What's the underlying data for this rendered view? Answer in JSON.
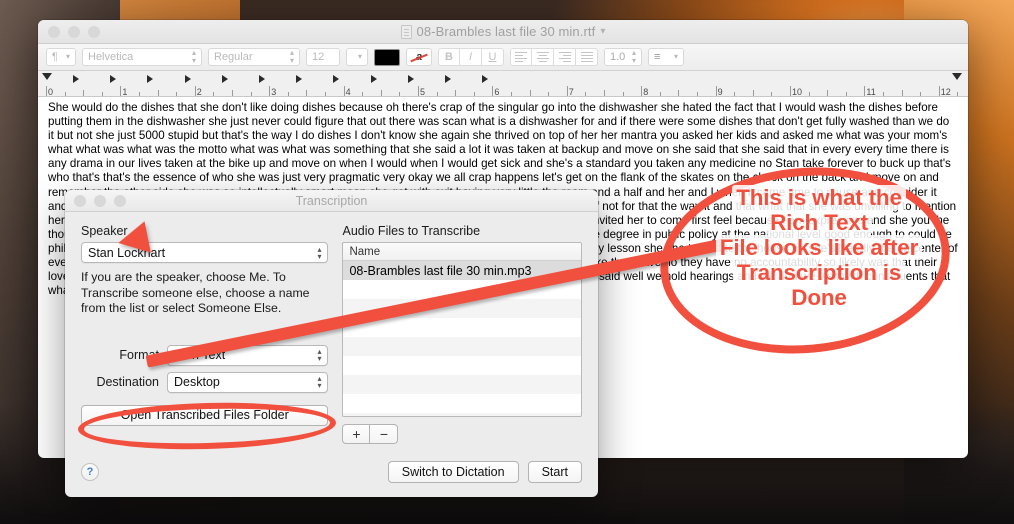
{
  "desktop": {
    "wallpaper_name": "macos-sierra-mountain-wallpaper"
  },
  "textedit": {
    "title": "08-Brambles last file 30 min.rtf",
    "title_chevron": "chevron-down-icon",
    "traffic_lights": [
      "close",
      "minimize",
      "zoom"
    ],
    "toolbar": {
      "paragraph_style": "¶",
      "font_family": "Helvetica",
      "font_style": "Regular",
      "font_size": "12",
      "color_swatch": "#000000",
      "highlight_label": "a",
      "bold_label": "B",
      "italic_label": "I",
      "underline_label": "U",
      "line_spacing": "1.0",
      "list_label": "list"
    },
    "ruler": {
      "numbers": [
        "0",
        "1",
        "2",
        "3",
        "4",
        "5",
        "6",
        "7",
        "8",
        "9",
        "10",
        "11",
        "12"
      ]
    },
    "document_text": "She would do the dishes that she don't like doing dishes because oh there's crap of the singular go into the dishwasher she hated the fact that I would wash the dishes before putting them in the dishwasher she just never could figure that out there was scan what is a dishwasher for and if there were some dishes that don't get fully washed than we do it but not she just 5000 stupid but that's the way I do dishes I don't know she again she thrived on top of her her mantra you asked her kids and asked me what was your mom's what what was what was the motto what was what was something that she said a lot it was taken at backup and move on she said that she said that in every every time there is any drama in our lives taken at the bike up and move on when I would when I would get sick and she's a standard you taken any medicine no Stan take forever to buck up that's who that's that's the essence of who she was just very pragmatic very okay we all crap happens let's get on the flank of the skates on the check on the back and move on and remember the other side she was so intellectually smart mean she got with exit having very little the room and a half and her and I when it came time to pause and consider it and I said and twice and almost ended at the edge of it and the became a doctor her only apply to the you if not for that the way it and that what that she was unwilling to mention herself in the program a dozen dozen times and they have invited her to come and any of me and they've invited her to come first feel because I am expressive and she you the thought but telling her I thought the stupid is the doesn't doesn't doesn't that and the point that you say have degree in public policy at the national level good enough to could be philosophy to get significant things done at the national level but Mike sound she did not want to be sincerely lesson she she told Mike the house for she's literally the epicenter of every political issue facing it's Congressman and Senators come speak every year the legislature I think Mike they have no they have no accountability so likely was that their love and love for Bob Bennett but I did vote from the primary that year and I congressman you do and Mike said well we hold hearings and we and we visit with constituents that what you actually get done oh not very much at all we have a"
  },
  "dialog": {
    "title": "Transcription",
    "traffic_lights": [
      "close",
      "minimize",
      "zoom"
    ],
    "speaker_label": "Speaker",
    "speaker_value": "Stan Lockhart",
    "speaker_help": "If you are the speaker, choose Me.  To Transcribe someone else, choose a name from the list or select Someone Else.",
    "format_label": "Format",
    "format_value": "Rich Text",
    "destination_label": "Destination",
    "destination_value": "Desktop",
    "open_folder_button": "Open Transcribed Files Folder",
    "audio_files_label": "Audio Files to Transcribe",
    "file_column_header": "Name",
    "files": [
      "08-Brambles last file 30 min.mp3"
    ],
    "add_button": "+",
    "remove_button": "−",
    "help_button": "?",
    "switch_button": "Switch to Dictation",
    "start_button": "Start"
  },
  "annotation": {
    "text_lines": [
      "This is what the",
      "Rich Text",
      "File looks like after",
      "Transcription is",
      "Done"
    ],
    "color": "#f2503e",
    "shapes": [
      "ellipse-around-result-text",
      "ellipse-around-open-folder-button",
      "arrow-pointing-to-result"
    ]
  }
}
